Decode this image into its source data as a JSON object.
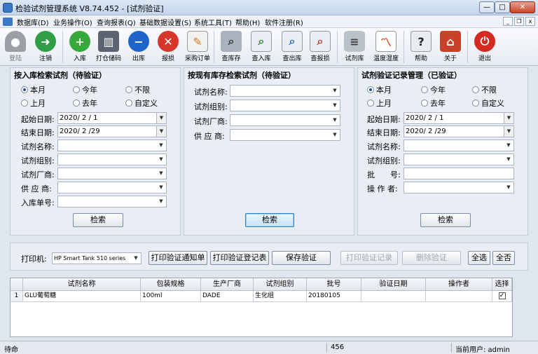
{
  "window": {
    "title": "检验试剂管理系统 V8.74.452 - [试剂验证]",
    "min": "—",
    "max": "□",
    "close": "✕"
  },
  "menu": [
    "数据库(D)",
    "业务操作(O)",
    "查询报表(Q)",
    "基础数据设置(S)",
    "系统工具(T)",
    "帮助(H)",
    "软件注册(R)"
  ],
  "mdi": {
    "min": "_",
    "restore": "❐",
    "close": "x"
  },
  "toolbar": [
    {
      "label": "登陆",
      "icon": "login-person-icon"
    },
    {
      "label": "注销",
      "icon": "logout-run-icon"
    },
    {
      "label": "入库",
      "icon": "plus-icon"
    },
    {
      "label": "打仓储码",
      "icon": "barcode-printer-icon"
    },
    {
      "label": "出库",
      "icon": "minus-icon"
    },
    {
      "label": "报损",
      "icon": "cross-icon"
    },
    {
      "label": "采购订单",
      "icon": "notepad-icon"
    },
    {
      "label": "查库存",
      "icon": "search-stock-icon"
    },
    {
      "label": "查入库",
      "icon": "search-in-icon"
    },
    {
      "label": "查出库",
      "icon": "search-out-icon"
    },
    {
      "label": "查报损",
      "icon": "search-loss-icon"
    },
    {
      "label": "试剂库",
      "icon": "database-icon"
    },
    {
      "label": "温度湿度",
      "icon": "chart-icon"
    },
    {
      "label": "帮助",
      "icon": "help-icon"
    },
    {
      "label": "关于",
      "icon": "house-icon"
    },
    {
      "label": "退出",
      "icon": "power-icon"
    }
  ],
  "left": {
    "title": "按入库检索试剂（待验证）",
    "radios": [
      "本月",
      "今年",
      "不限",
      "上月",
      "去年",
      "自定义"
    ],
    "start_label": "起始日期:",
    "start_value": "2020/ 2 / 1",
    "end_label": "结束日期:",
    "end_value": "2020/ 2 /29",
    "name_label": "试剂名称:",
    "group_label": "试剂组别:",
    "maker_label": "试剂厂商:",
    "supplier_label": "供 应 商:",
    "order_label": "入库单号:",
    "search": "检索"
  },
  "middle": {
    "title": "按现有库存检索试剂（待验证）",
    "name_label": "试剂名称:",
    "group_label": "试剂组别:",
    "maker_label": "试剂厂商:",
    "supplier_label": "供 应 商:",
    "search": "检索"
  },
  "right": {
    "title": "试剂验证记录管理（已验证）",
    "radios": [
      "本月",
      "今年",
      "不限",
      "上月",
      "去年",
      "自定义"
    ],
    "start_label": "起始日期:",
    "start_value": "2020/ 2 / 1",
    "end_label": "结束日期:",
    "end_value": "2020/ 2 /29",
    "name_label": "试剂名称:",
    "group_label": "试剂组别:",
    "batch_label": "批　　号:",
    "operator_label": "操 作 者:",
    "search": "检索"
  },
  "actions": {
    "printer_label": "打印机:",
    "printer_value": "HP Smart Tank 510 series",
    "print_notice": "打印验证通知单",
    "print_record": "打印验证登记表",
    "save": "保存验证",
    "print_verify_record": "打印验证记录",
    "delete": "删除验证",
    "select_all": "全选",
    "select_none": "全否"
  },
  "grid": {
    "headers": [
      "试剂名称",
      "包装规格",
      "生产厂商",
      "试剂组别",
      "批号",
      "验证日期",
      "操作者",
      "选择"
    ],
    "rows": [
      {
        "num": "1",
        "cells": [
          "GLU葡萄糖",
          "100ml",
          "DADE",
          "生化组",
          "20180105",
          "",
          ""
        ],
        "checked": "✓"
      }
    ]
  },
  "status": {
    "left": "待命",
    "middle": "456",
    "right": "当前用户: admin"
  }
}
